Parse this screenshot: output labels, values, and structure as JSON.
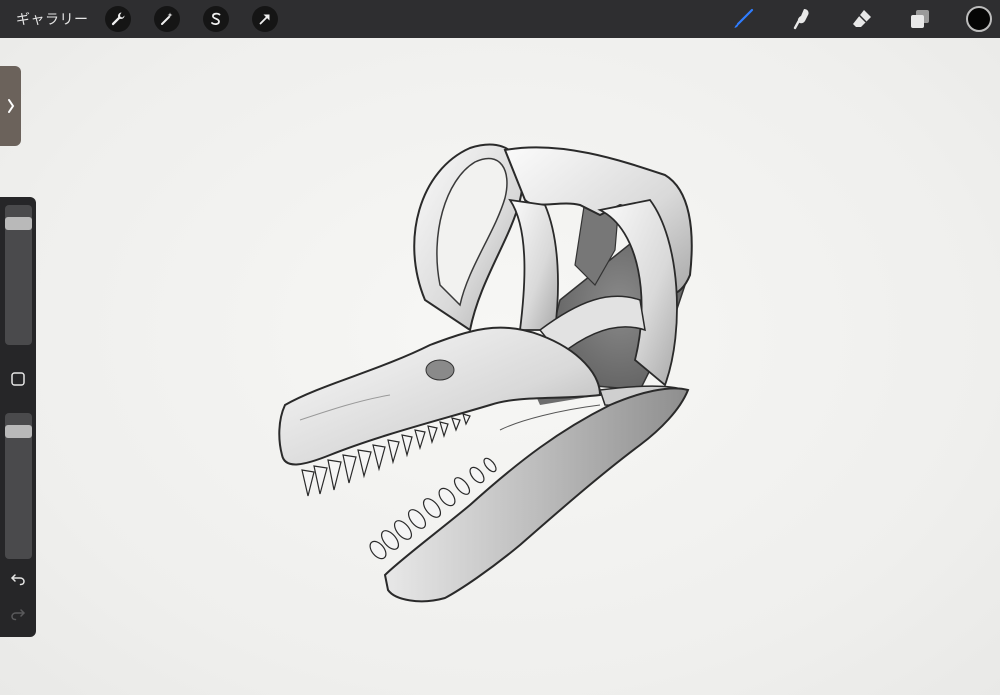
{
  "topbar": {
    "gallery_label": "ギャラリー",
    "left_tools": [
      {
        "name": "actions",
        "icon": "wrench-icon"
      },
      {
        "name": "adjustments",
        "icon": "magic-wand-icon"
      },
      {
        "name": "selection",
        "icon": "selection-s-icon"
      },
      {
        "name": "transform",
        "icon": "arrow-cursor-icon"
      }
    ],
    "right_tools": [
      {
        "name": "brush",
        "icon": "brush-icon",
        "active": true
      },
      {
        "name": "smudge",
        "icon": "smudge-icon"
      },
      {
        "name": "eraser",
        "icon": "eraser-icon"
      },
      {
        "name": "layers",
        "icon": "layers-icon"
      }
    ],
    "active_color": "#050505",
    "accent_color": "#2f7dff"
  },
  "sidebar": {
    "brush_size_level": 0.9,
    "opacity_level": 0.95,
    "buttons": [
      "modify-square-icon",
      "undo-icon",
      "redo-icon"
    ]
  },
  "canvas": {
    "subject": "sauropod-skull-sketch",
    "background": "#f2f2f0"
  }
}
